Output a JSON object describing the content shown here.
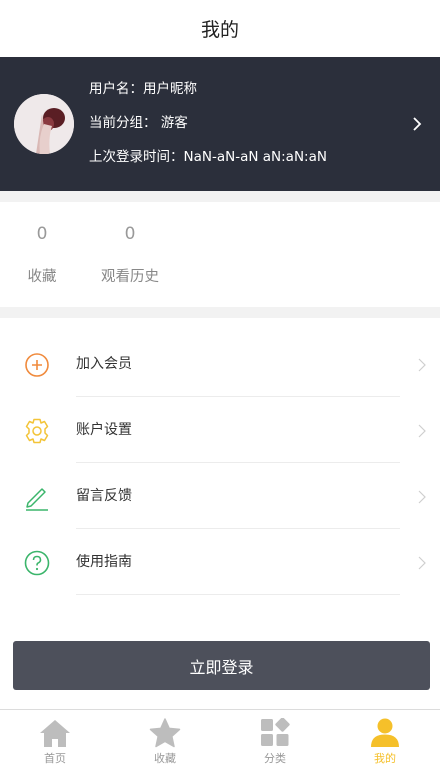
{
  "header": {
    "title": "我的"
  },
  "profile": {
    "username": "用户名：用户昵称",
    "group": "当前分组：  游客",
    "last_login": "上次登录时间：NaN-aN-aN aN:aN:aN"
  },
  "stats": [
    {
      "value": "0",
      "label": "收藏"
    },
    {
      "value": "0",
      "label": "观看历史"
    }
  ],
  "menu": [
    {
      "label": "加入会员",
      "icon": "plus-circle-icon",
      "color": "#f08a3c"
    },
    {
      "label": "账户设置",
      "icon": "gear-icon",
      "color": "#f3c438"
    },
    {
      "label": "留言反馈",
      "icon": "pencil-icon",
      "color": "#3bb56b"
    },
    {
      "label": "使用指南",
      "icon": "question-circle-icon",
      "color": "#3bb56b"
    }
  ],
  "login_button": "立即登录",
  "tabs": [
    {
      "label": "首页",
      "icon": "home-icon"
    },
    {
      "label": "收藏",
      "icon": "star-icon"
    },
    {
      "label": "分类",
      "icon": "category-icon"
    },
    {
      "label": "我的",
      "icon": "user-icon",
      "active": true
    }
  ],
  "colors": {
    "accent": "#f5c02a",
    "profile_bg": "#2b2f3b",
    "button_bg": "#4d505b"
  }
}
